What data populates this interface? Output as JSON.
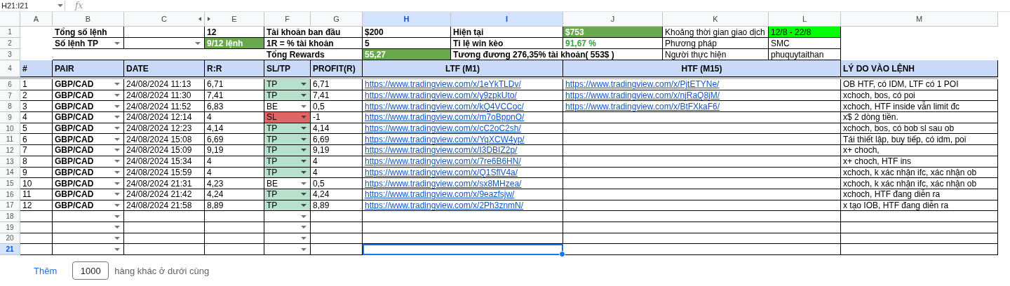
{
  "formula_bar": {
    "cell_reference": "H21:I21",
    "function_label": "fx"
  },
  "column_headers": [
    {
      "label": "A",
      "selected": false
    },
    {
      "label": "B",
      "selected": false
    },
    {
      "label": "C",
      "selected": false
    },
    {
      "label": "E",
      "selected": false
    },
    {
      "label": "F",
      "selected": false
    },
    {
      "label": "G",
      "selected": false
    },
    {
      "label": "H",
      "selected": true
    },
    {
      "label": "I",
      "selected": true
    },
    {
      "label": "J",
      "selected": false
    },
    {
      "label": "K",
      "selected": false
    },
    {
      "label": "L",
      "selected": false
    },
    {
      "label": "M",
      "selected": false
    }
  ],
  "summary": {
    "row_numbers": [
      "1",
      "2",
      "3"
    ],
    "total_orders_label": "Tổng số lệnh",
    "total_orders": "12",
    "tp_orders_label": "Số lệnh TP",
    "tp_orders": "9/12 lệnh",
    "initial_balance_label": "Tài khoản ban đầu",
    "initial_balance": "$200",
    "risk_label": "1R = % tài khoản",
    "risk": "5",
    "total_rewards_label": "Tổng Rewards",
    "total_rewards": "55,27",
    "current_label": "Hiện tại",
    "current": "$753",
    "win_rate_label": "Tỉ lệ win kèo",
    "win_rate": "91,67 %",
    "equivalent": "Tương đương 276,35% tài khoản( 553$ )",
    "period_label": "Khoảng thời gian giao dịch",
    "period": "12/8 - 22/8",
    "method_label": "Phương pháp",
    "method": "SMC",
    "author_label": "Người thực hiện",
    "author": "phuquytaithan"
  },
  "table": {
    "header_row_number": "4",
    "columns": [
      "#",
      "PAIR",
      "DATE",
      "R:R",
      "SL/TP",
      "PROFIT(R)",
      "LTF (M1)",
      "HTF (M15)",
      "LÝ DO VÀO LỆNH"
    ],
    "rows": [
      {
        "kind": "tp",
        "row_number": "6",
        "index": "1",
        "pair": "GBP/CAD",
        "date": "24/08/2024 11:13",
        "rr": "6,71",
        "result": "TP",
        "profit": "6,71",
        "ltf": "https://www.tradingview.com/x/1eYkTLDv/",
        "htf": "https://www.tradingview.com/x/PjtETYNe/",
        "reason": "OB HTF, có IDM, LTF có 1 POI"
      },
      {
        "kind": "tp",
        "row_number": "7",
        "index": "2",
        "pair": "GBP/CAD",
        "date": "24/08/2024 11:30",
        "rr": "7,41",
        "result": "TP",
        "profit": "7,41",
        "ltf": "https://www.tradingview.com/x/y9zpkUto/",
        "htf": "https://www.tradingview.com/x/njRaQ8jM/",
        "reason": "xchoch, bos, có poi"
      },
      {
        "kind": "be",
        "row_number": "8",
        "index": "3",
        "pair": "GBP/CAD",
        "date": "24/08/2024 11:52",
        "rr": "6,83",
        "result": "BE",
        "profit": "0,5",
        "ltf": "https://www.tradingview.com/x/kQ4VCCoc/",
        "htf": "https://www.tradingview.com/x/BtFXkaF6/",
        "reason": "xchoch, HTF inside vẫn limit đc"
      },
      {
        "kind": "sl",
        "row_number": "9",
        "index": "4",
        "pair": "GBP/CAD",
        "date": "24/08/2024 12:14",
        "rr": "4",
        "result": "SL",
        "profit": "-1",
        "ltf": "https://www.tradingview.com/x/m7oBppnO/",
        "reason": "x$ 2 dòng tiền."
      },
      {
        "kind": "tp",
        "row_number": "10",
        "index": "5",
        "pair": "GBP/CAD",
        "date": "24/08/2024 12:23",
        "rr": "4,14",
        "result": "TP",
        "profit": "4,14",
        "ltf": "https://www.tradingview.com/x/cC2oC2sh/",
        "reason": "xchoch, bos, có bob sl sau ob"
      },
      {
        "kind": "tp",
        "row_number": "11",
        "index": "6",
        "pair": "GBP/CAD",
        "date": "24/08/2024 15:08",
        "rr": "6,69",
        "result": "TP",
        "profit": "6,69",
        "ltf": "https://www.tradingview.com/x/YqXCW4yp/",
        "reason": "Tái thiết lập, buy tiếp, có idm, poi"
      },
      {
        "kind": "tp",
        "row_number": "12",
        "index": "7",
        "pair": "GBP/CAD",
        "date": "24/08/2024 15:09",
        "rr": "9,19",
        "result": "TP",
        "profit": "9,19",
        "ltf": "https://www.tradingview.com/x/I3DBIZ2p/",
        "reason": "x+ choch,"
      },
      {
        "kind": "tp",
        "row_number": "13",
        "index": "8",
        "pair": "GBP/CAD",
        "date": "24/08/2024 15:34",
        "rr": "4",
        "result": "TP",
        "profit": "4",
        "ltf": "https://www.tradingview.com/x/7re6B6HN/",
        "reason": "x+ choch, HTF ins"
      },
      {
        "kind": "tp",
        "row_number": "14",
        "index": "9",
        "pair": "GBP/CAD",
        "date": "24/08/2024 15:59",
        "rr": "4",
        "result": "TP",
        "profit": "4",
        "ltf": "https://www.tradingview.com/x/Q1SflV4a/",
        "reason": "xchoch, k xác nhận ifc, xác nhận ob"
      },
      {
        "kind": "be",
        "row_number": "15",
        "index": "10",
        "pair": "GBP/CAD",
        "date": "24/08/2024 21:31",
        "rr": "4,23",
        "result": "BE",
        "profit": "0,5",
        "ltf": "https://www.tradingview.com/x/sx8MHzea/",
        "reason": "xchoch, k xác nhận ifc, xác nhận ob"
      },
      {
        "kind": "tp",
        "row_number": "16",
        "index": "11",
        "pair": "GBP/CAD",
        "date": "24/08/2024 21:42",
        "rr": "4,24",
        "result": "TP",
        "profit": "4,24",
        "ltf": "https://www.tradingview.com/x/9eazfsjw/",
        "reason": "xchoch, HTF đang diễn ra"
      },
      {
        "kind": "tp",
        "row_number": "17",
        "index": "12",
        "pair": "GBP/CAD",
        "date": "24/08/2024 21:58",
        "rr": "8,89",
        "result": "TP",
        "profit": "8,89",
        "ltf": "https://www.tradingview.com/x/2Ph3znmN/",
        "reason": "x tạo IOB, HTF đang diễn ra"
      }
    ],
    "blank_rows": [
      {
        "row_number": "18",
        "selected": false
      },
      {
        "row_number": "19",
        "selected": false
      },
      {
        "row_number": "20",
        "selected": false
      },
      {
        "row_number": "21",
        "selected": true
      }
    ]
  },
  "footer": {
    "add_button": "Thêm",
    "row_count": "1000",
    "suffix": "hàng khác ở dưới cùng"
  }
}
